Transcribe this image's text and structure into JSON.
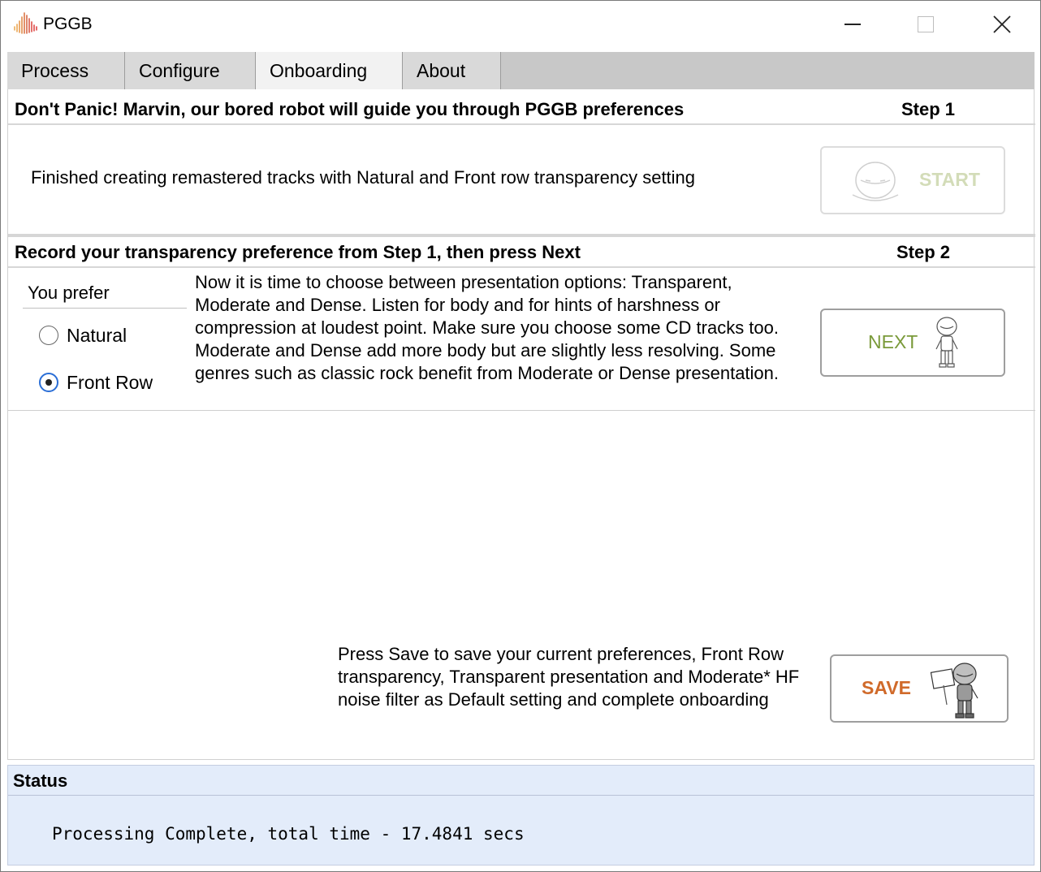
{
  "window": {
    "title": "PGGB",
    "logo_icon": "pggb-waveform-logo-icon"
  },
  "tabs": [
    {
      "label": "Process",
      "active": false
    },
    {
      "label": "Configure",
      "active": false
    },
    {
      "label": "Onboarding",
      "active": true
    },
    {
      "label": "About",
      "active": false
    }
  ],
  "step1": {
    "header": "Don't Panic! Marvin, our bored robot will guide you through PGGB preferences",
    "step_label": "Step 1",
    "message": "Finished creating remastered tracks with Natural and Front row  transparency setting",
    "start_label": "START"
  },
  "step2": {
    "header": "Record your transparency  preference  from Step 1, then press Next",
    "step_label": "Step 2",
    "prefer_label": "You prefer",
    "options": [
      {
        "label": "Natural",
        "checked": false
      },
      {
        "label": "Front Row",
        "checked": true
      }
    ],
    "description": "Now it is time to choose between presentation options: Transparent, Moderate and Dense. Listen for body and for hints of harshness or compression at loudest point. Make sure you choose some CD tracks too. Moderate and Dense add more body but are slightly less resolving. Some genres such as classic rock benefit from Moderate or Dense presentation.",
    "next_label": "NEXT"
  },
  "save": {
    "description": "Press Save to save your current preferences, Front Row transparency, Transparent presentation and Moderate* HF noise filter  as Default setting and complete onboarding",
    "save_label": "SAVE"
  },
  "status": {
    "title": "Status",
    "text": "Processing Complete, total time - 17.4841 secs"
  },
  "colors": {
    "start_text": "#d3dcb8",
    "next_text": "#7a9a3a",
    "save_text": "#d06a2a",
    "status_bg": "#e3ecfa",
    "radio_accent": "#2a6ed6"
  }
}
